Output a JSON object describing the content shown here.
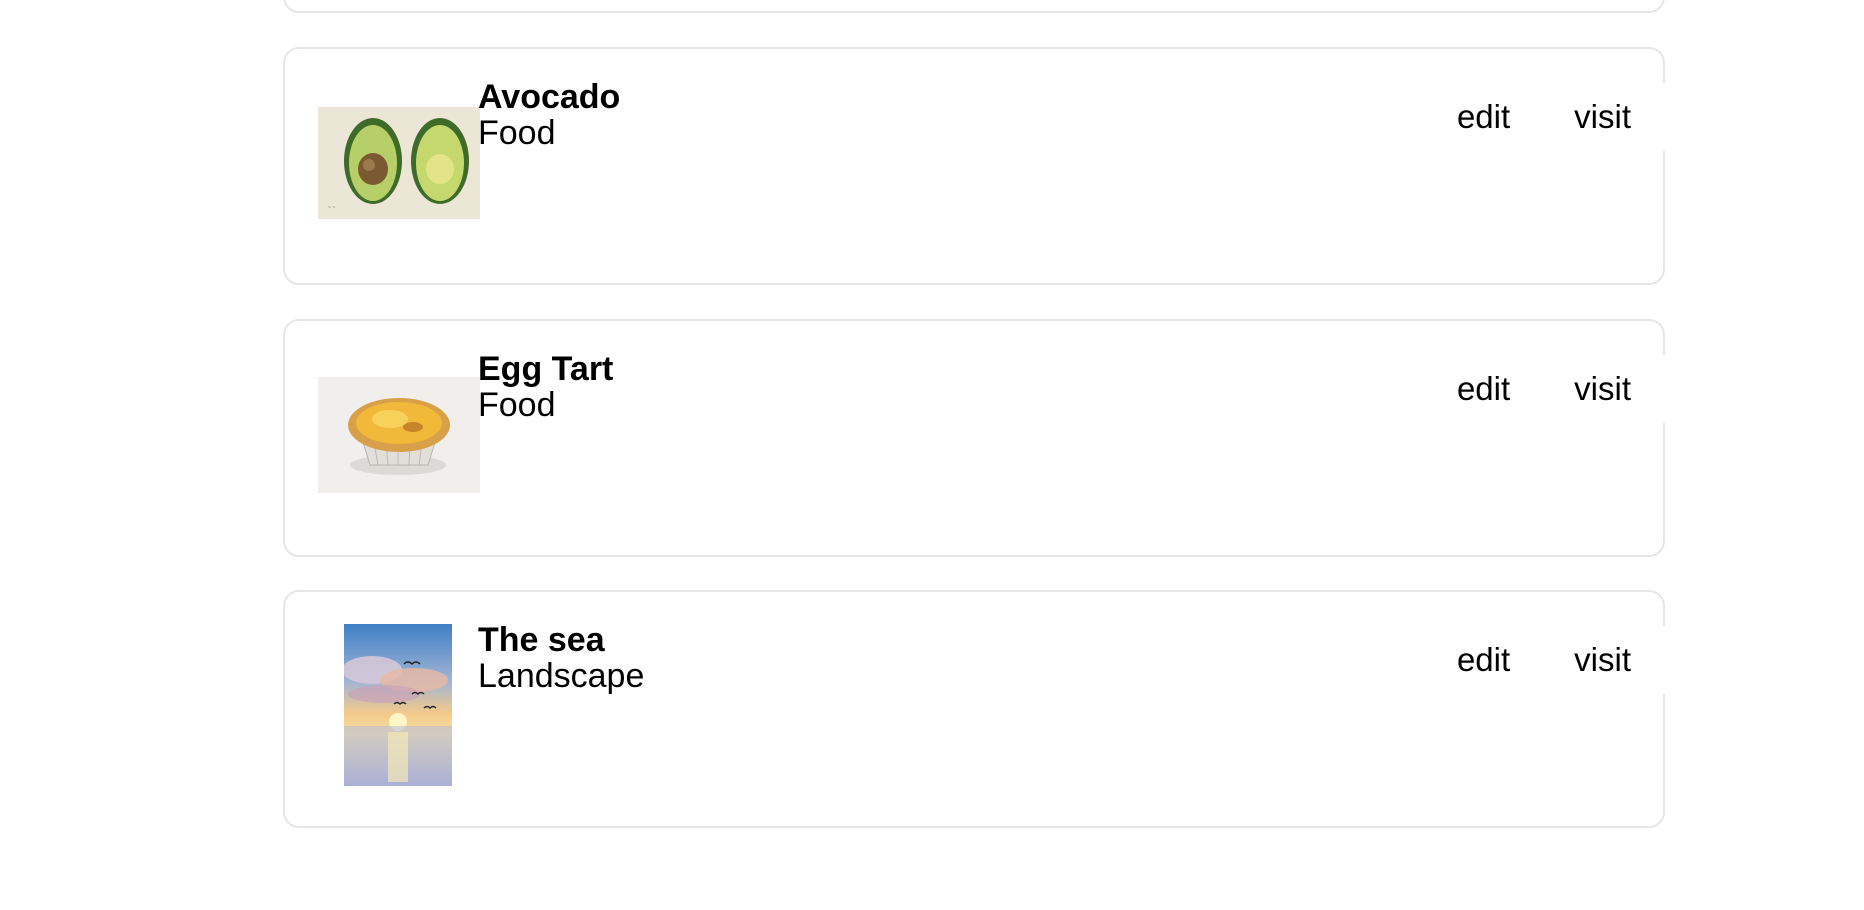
{
  "items": [
    {
      "title": "Avocado",
      "category": "Food",
      "image": "avocado-painting",
      "edit_label": "edit",
      "visit_label": "visit"
    },
    {
      "title": "Egg Tart",
      "category": "Food",
      "image": "egg-tart-painting",
      "edit_label": "edit",
      "visit_label": "visit"
    },
    {
      "title": "The sea",
      "category": "Landscape",
      "image": "sea-sunset-painting",
      "edit_label": "edit",
      "visit_label": "visit"
    }
  ]
}
